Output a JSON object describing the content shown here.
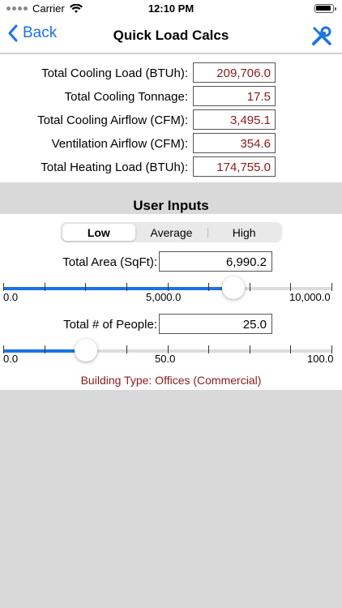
{
  "status_bar": {
    "carrier": "Carrier",
    "time": "12:10 PM",
    "battery_icon": "battery-full-icon",
    "wifi_icon": "wifi-icon"
  },
  "nav": {
    "back_label": "Back",
    "title": "Quick Load Calcs",
    "tools_icon": "tools-icon"
  },
  "results": [
    {
      "label": "Total Cooling Load (BTUh):",
      "value": "209,706.0"
    },
    {
      "label": "Total Cooling Tonnage:",
      "value": "17.5"
    },
    {
      "label": "Total Cooling Airflow (CFM):",
      "value": "3,495.1"
    },
    {
      "label": "Ventilation Airflow (CFM):",
      "value": "354.6"
    },
    {
      "label": "Total Heating Load (BTUh):",
      "value": "174,755.0"
    }
  ],
  "user_inputs": {
    "header": "User Inputs",
    "segments": [
      "Low",
      "Average",
      "High"
    ],
    "selected_segment": "Low",
    "area": {
      "label": "Total Area (SqFt):",
      "value": "6,990.2",
      "slider": {
        "min": 0,
        "max": 10000,
        "value": 6990.2,
        "min_label": "0.0",
        "mid_label": "5,000.0",
        "max_label": "10,000.0"
      }
    },
    "people": {
      "label": "Total # of People:",
      "value": "25.0",
      "slider": {
        "min": 0,
        "max": 100,
        "value": 25,
        "min_label": "0.0",
        "mid_label": "50.0",
        "max_label": "100.0"
      }
    },
    "building_type": "Building Type: Offices (Commercial)"
  },
  "colors": {
    "accent": "#1a73e8",
    "result_text": "#8b1a1a",
    "background": "#d9d9d9"
  }
}
